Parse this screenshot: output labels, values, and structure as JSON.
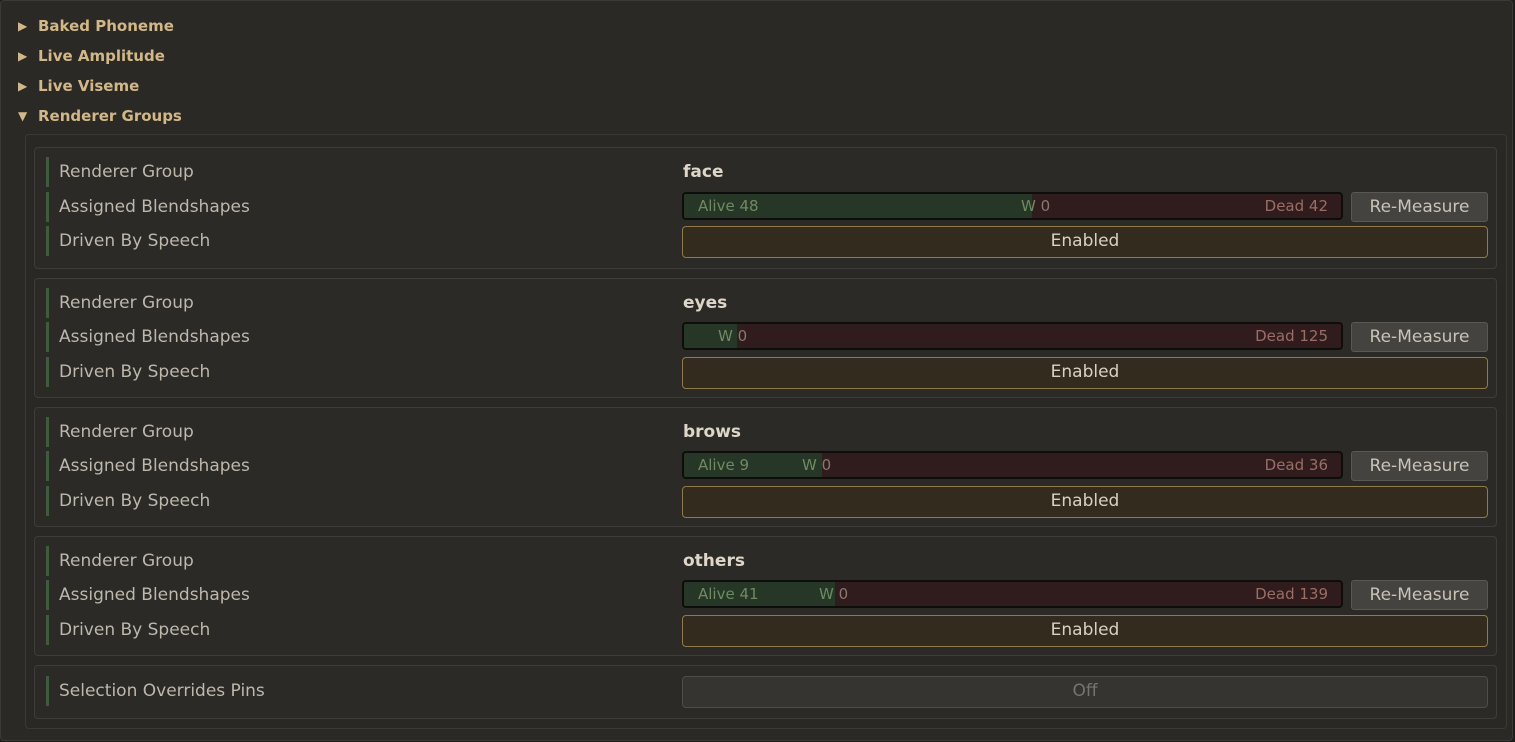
{
  "foldouts": [
    {
      "label": "Baked Phoneme",
      "expanded": false
    },
    {
      "label": "Live Amplitude",
      "expanded": false
    },
    {
      "label": "Live Viseme",
      "expanded": false
    },
    {
      "label": "Renderer Groups",
      "expanded": true
    }
  ],
  "labels": {
    "renderer_group": "Renderer Group",
    "assigned_blendshapes": "Assigned Blendshapes",
    "driven_by_speech": "Driven By Speech",
    "remeasure": "Re-Measure"
  },
  "groups": [
    {
      "name": "face",
      "alive_text": "Alive 48",
      "w_text": "W",
      "w_value": "0",
      "dead_text": "Dead 42",
      "alive_fraction": 0.53,
      "driven": "Enabled"
    },
    {
      "name": "eyes",
      "alive_text": "",
      "w_text": "W",
      "w_value": "0",
      "dead_text": "Dead 125",
      "alive_fraction": 0.08,
      "driven": "Enabled"
    },
    {
      "name": "brows",
      "alive_text": "Alive 9",
      "w_text": "W",
      "w_value": "0",
      "dead_text": "Dead 36",
      "alive_fraction": 0.21,
      "driven": "Enabled"
    },
    {
      "name": "others",
      "alive_text": "Alive 41",
      "w_text": "W",
      "w_value": "0",
      "dead_text": "Dead 139",
      "alive_fraction": 0.23,
      "driven": "Enabled"
    }
  ],
  "selection": {
    "label": "Selection Overrides Pins",
    "value": "Off"
  },
  "colors": {
    "accent": "#d2b888",
    "alive": "#263727",
    "dead": "#301c1d",
    "enabled_border": "#8f7a48"
  }
}
